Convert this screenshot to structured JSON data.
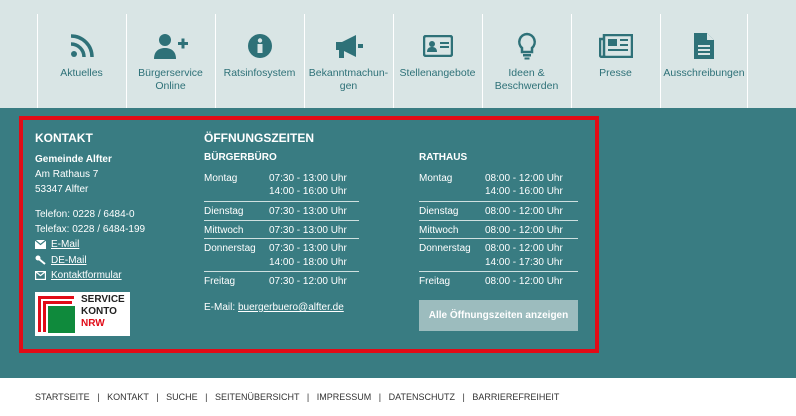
{
  "nav": [
    {
      "label": "Aktuelles",
      "icon": "rss-icon"
    },
    {
      "label": "Bürgerservice Online",
      "icon": "user-plus-icon"
    },
    {
      "label": "Ratsinfosystem",
      "icon": "info-icon"
    },
    {
      "label": "Bekanntmachun-gen",
      "icon": "megaphone-icon"
    },
    {
      "label": "Stellenangebote",
      "icon": "id-card-icon"
    },
    {
      "label": "Ideen & Beschwerden",
      "icon": "lightbulb-icon"
    },
    {
      "label": "Presse",
      "icon": "newspaper-icon"
    },
    {
      "label": "Ausschreibungen",
      "icon": "document-icon"
    }
  ],
  "kontakt": {
    "heading": "KONTAKT",
    "org": "Gemeinde Alfter",
    "street": "Am Rathaus 7",
    "city": "53347 Alfter",
    "phone": "Telefon: 0228 / 6484-0",
    "fax": "Telefax: 0228 / 6484-199",
    "email": "E-Mail",
    "demail": "DE-Mail",
    "form": "Kontaktformular",
    "servicekonto": {
      "line1": "SERVICE",
      "line2": "KONTO",
      "line3": "NRW"
    }
  },
  "hours": {
    "heading": "ÖFFNUNGSZEITEN",
    "buergerbuero": {
      "title": "BÜRGERBÜRO",
      "rows": [
        {
          "day": "Montag",
          "times": [
            "07:30 - 13:00 Uhr",
            "14:00 - 16:00 Uhr"
          ]
        },
        {
          "day": "Dienstag",
          "times": [
            "07:30 - 13:00 Uhr"
          ]
        },
        {
          "day": "Mittwoch",
          "times": [
            "07:30 - 13:00 Uhr"
          ]
        },
        {
          "day": "Donnerstag",
          "times": [
            "07:30 - 13:00 Uhr",
            "14:00 - 18:00 Uhr"
          ]
        },
        {
          "day": "Freitag",
          "times": [
            "07:30 - 12:00 Uhr"
          ]
        }
      ],
      "email_label": "E-Mail:",
      "email": "buergerbuero@alfter.de"
    },
    "rathaus": {
      "title": "RATHAUS",
      "rows": [
        {
          "day": "Montag",
          "times": [
            "08:00 - 12:00 Uhr",
            "14:00 - 16:00 Uhr"
          ]
        },
        {
          "day": "Dienstag",
          "times": [
            "08:00 - 12:00 Uhr"
          ]
        },
        {
          "day": "Mittwoch",
          "times": [
            "08:00 - 12:00 Uhr"
          ]
        },
        {
          "day": "Donnerstag",
          "times": [
            "08:00 - 12:00 Uhr",
            "14:00 - 17:30 Uhr"
          ]
        },
        {
          "day": "Freitag",
          "times": [
            "08:00 - 12:00 Uhr"
          ]
        }
      ],
      "button": "Alle Öffnungszeiten anzeigen"
    }
  },
  "bottom_links": [
    "STARTSEITE",
    "KONTAKT",
    "SUCHE",
    "SEITENÜBERSICHT",
    "IMPRESSUM",
    "DATENSCHUTZ",
    "BARRIEREFREIHEIT"
  ],
  "colors": {
    "teal": "#397c82",
    "nav_bg": "#d9e5e5",
    "nav_icon": "#2e7178",
    "highlight": "#e10b17"
  }
}
